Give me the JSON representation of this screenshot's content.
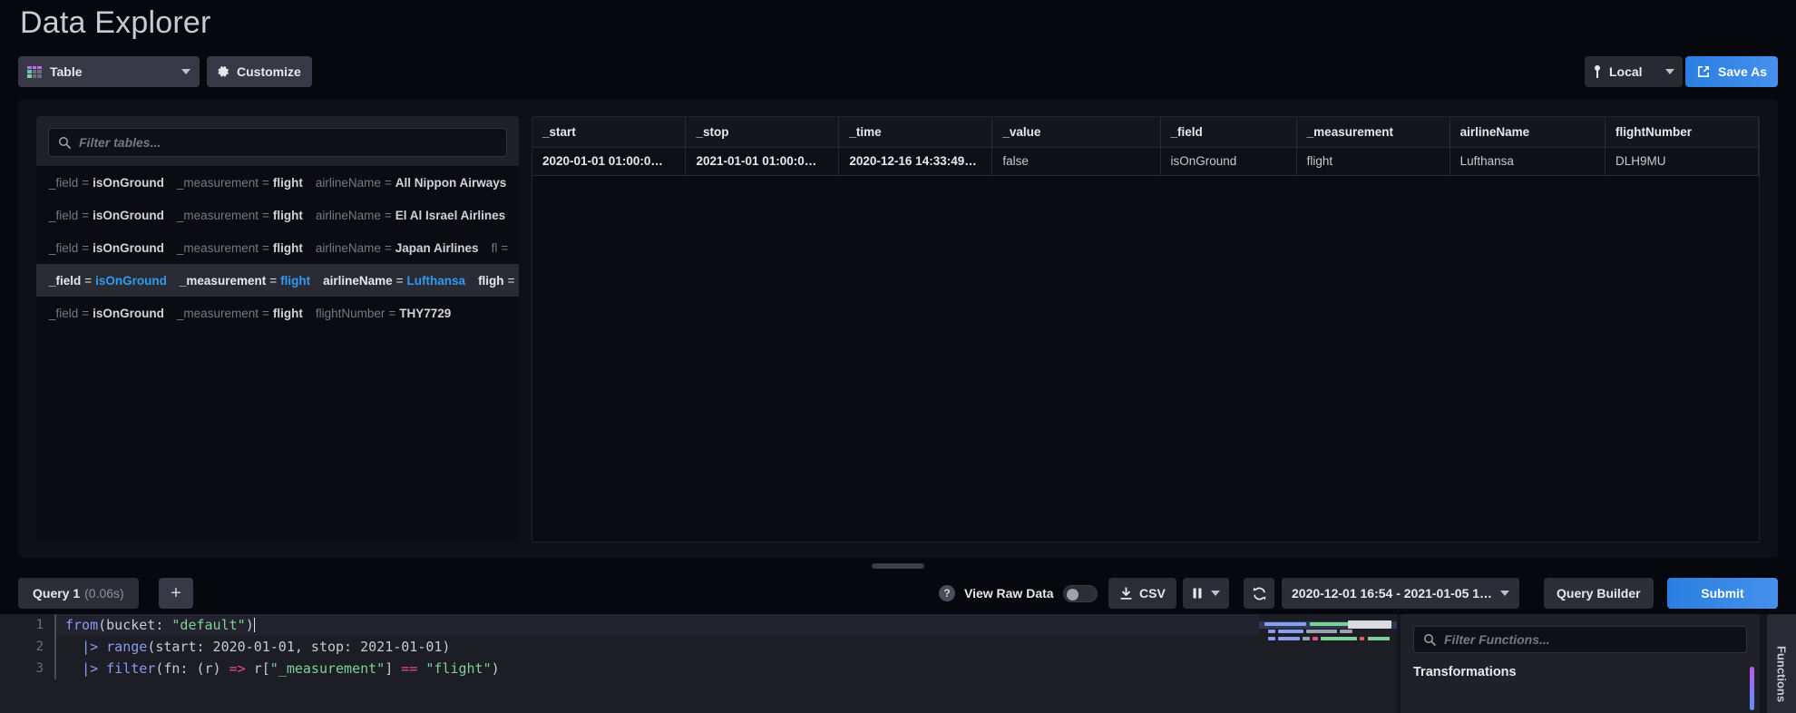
{
  "page": {
    "title": "Data Explorer"
  },
  "toolbar": {
    "viz_type": "Table",
    "viz_icon": "table-icon",
    "customize_label": "Customize",
    "customize_icon": "gear-icon",
    "local_label": "Local",
    "local_icon": "clock-pin-icon",
    "save_as_label": "Save As",
    "save_as_icon": "export-icon",
    "accent_blue": "#4591ec"
  },
  "tables_pane": {
    "filter_placeholder": "Filter tables...",
    "filter_value": "",
    "search_icon": "search-icon",
    "items": [
      {
        "selected": false,
        "pairs": [
          {
            "key": "_field",
            "value": "isOnGround"
          },
          {
            "key": "_measurement",
            "value": "flight"
          },
          {
            "key": "airlineName",
            "value": "All Nippon Airways"
          }
        ]
      },
      {
        "selected": false,
        "pairs": [
          {
            "key": "_field",
            "value": "isOnGround"
          },
          {
            "key": "_measurement",
            "value": "flight"
          },
          {
            "key": "airlineName",
            "value": "El Al Israel Airlines"
          }
        ]
      },
      {
        "selected": false,
        "pairs": [
          {
            "key": "_field",
            "value": "isOnGround"
          },
          {
            "key": "_measurement",
            "value": "flight"
          },
          {
            "key": "airlineName",
            "value": "Japan Airlines"
          },
          {
            "key": "fl",
            "value": ""
          }
        ]
      },
      {
        "selected": true,
        "pairs": [
          {
            "key": "_field",
            "value": "isOnGround"
          },
          {
            "key": "_measurement",
            "value": "flight"
          },
          {
            "key": "airlineName",
            "value": "Lufthansa"
          },
          {
            "key": "fligh",
            "value": ""
          }
        ]
      },
      {
        "selected": false,
        "pairs": [
          {
            "key": "_field",
            "value": "isOnGround"
          },
          {
            "key": "_measurement",
            "value": "flight"
          },
          {
            "key": "flightNumber",
            "value": "THY7729"
          }
        ]
      }
    ]
  },
  "data_table": {
    "columns": [
      "_start",
      "_stop",
      "_time",
      "_value",
      "_field",
      "_measurement",
      "airlineName",
      "flightNumber"
    ],
    "rows": [
      [
        "2020-01-01 01:00:0…",
        "2021-01-01 01:00:0…",
        "2020-12-16 14:33:49…",
        "false",
        "isOnGround",
        "flight",
        "Lufthansa",
        "DLH9MU"
      ]
    ]
  },
  "query_bar": {
    "query_label": "Query 1",
    "query_duration": "(0.06s)",
    "add_query_label": "+",
    "raw_data_label": "View Raw Data",
    "raw_data_on": false,
    "help_icon": "question-mark-icon",
    "csv_label": "CSV",
    "csv_icon": "download-icon",
    "pause_icon": "pause-icon",
    "refresh_icon": "refresh-icon",
    "time_range": "2020-12-01 16:54 - 2021-01-05 1…",
    "query_builder_label": "Query Builder",
    "submit_label": "Submit"
  },
  "editor": {
    "line_numbers": [
      "1",
      "2",
      "3"
    ],
    "lines": [
      "from(bucket: \"default\")",
      "  |> range(start: 2020-01-01, stop: 2021-01-01)",
      "  |> filter(fn: (r) => r[\"_measurement\"] == \"flight\")"
    ]
  },
  "functions_panel": {
    "filter_placeholder": "Filter Functions...",
    "filter_value": "",
    "search_icon": "search-icon",
    "section_title": "Transformations",
    "side_tab_label": "Functions"
  }
}
